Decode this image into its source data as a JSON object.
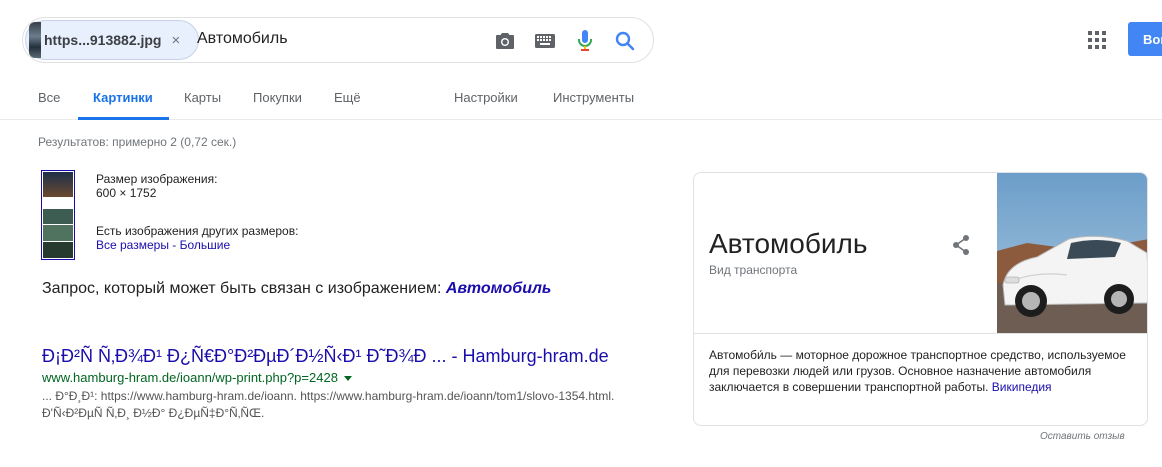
{
  "search": {
    "image_chip_name": "https...913882.jpg",
    "chip_close": "×",
    "query": "Автомобиль"
  },
  "header": {
    "login_label": "Войти"
  },
  "tabs": [
    {
      "label": "Все"
    },
    {
      "label": "Картинки"
    },
    {
      "label": "Карты"
    },
    {
      "label": "Покупки"
    },
    {
      "label": "Ещё"
    },
    {
      "label": "Настройки"
    },
    {
      "label": "Инструменты"
    }
  ],
  "results_count": "Результатов: примерно 2 (0,72 сек.)",
  "image_info": {
    "size_label": "Размер изображения:",
    "size_value": "600 × 1752",
    "other_sizes_label": "Есть изображения других размеров:",
    "all_sizes_link": "Все размеры",
    "separator": " - ",
    "large_link": "Большие"
  },
  "related": {
    "prefix": "Запрос, который может быть связан с изображением: ",
    "link": "Автомобиль"
  },
  "result": {
    "title": "Ð¡Ð²Ñ Ñ‚Ð¾Ð¹ Ð¿Ñ€Ð°Ð²ÐµÐ´Ð½Ñ‹Ð¹ Ð˜Ð¾Ð ... - Hamburg-hram.de",
    "url": "www.hamburg-hram.de/ioann/wp-print.php?p=2428",
    "snippet": "... Ð°Ð¸Ð¹: https://www.hamburg-hram.de/ioann. https://www.hamburg-hram.de/ioann/tom1/slovo-1354.html. Ð'Ñ‹Ð²ÐµÑ Ñ‚Ð¸ Ð½Ð° Ð¿ÐµÑ‡Ð°Ñ‚ÑŒ."
  },
  "knowledge_panel": {
    "title": "Автомобиль",
    "subtitle": "Вид транспорта",
    "description": "Автомоби́ль — моторное дорожное транспортное средство, используемое для перевозки людей или грузов. Основное назначение автомобиля заключается в совершении транспортной работы. ",
    "source_link": "Википедия"
  },
  "feedback": "Оставить отзыв",
  "icons": {
    "camera": "camera-icon",
    "keyboard": "keyboard-icon",
    "mic": "mic-icon",
    "search": "search-icon",
    "apps": "apps-grid-icon",
    "share": "share-icon"
  },
  "colors": {
    "accent": "#1a73e8",
    "link": "#1a0dab",
    "url_green": "#006621",
    "button_blue": "#4285f4"
  }
}
